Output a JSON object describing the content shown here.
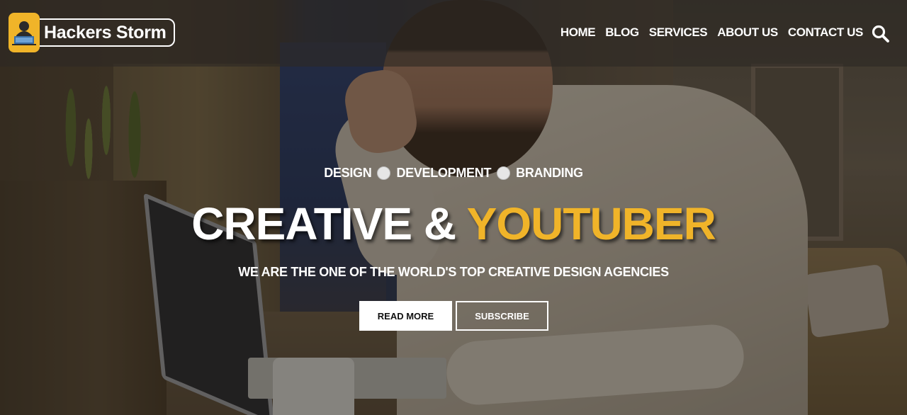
{
  "brand": {
    "name": "Hackers Storm",
    "logo_icon": "hacker-laptop-icon",
    "accent_color": "#f0b429"
  },
  "nav": {
    "items": [
      {
        "label": "HOME"
      },
      {
        "label": "BLOG"
      },
      {
        "label": "SERVICES"
      },
      {
        "label": "ABOUT US"
      },
      {
        "label": "CONTACT US"
      }
    ],
    "search_icon": "search-icon"
  },
  "hero": {
    "tagline": [
      "DESIGN",
      "DEVELOPMENT",
      "BRANDING"
    ],
    "headline_white": "CREATIVE &",
    "headline_yellow": "YOUTUBER",
    "subtitle": "WE ARE THE ONE OF THE WORLD'S TOP CREATIVE DESIGN AGENCIES",
    "primary_button": "READ MORE",
    "secondary_button": "SUBSCRIBE"
  }
}
